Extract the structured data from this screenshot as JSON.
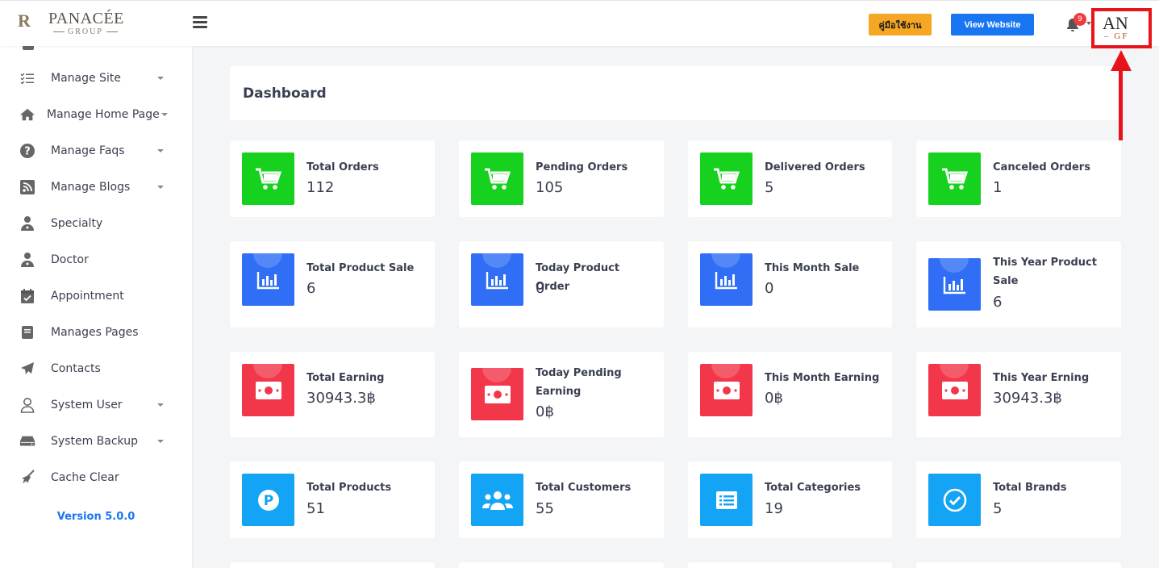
{
  "header": {
    "logo_monogram": "R",
    "logo_brand": "PANACÉE",
    "logo_group": "GROUP",
    "manual_button": "คู่มือใช้งาน",
    "view_website_button": "View Website",
    "notification_count": "9",
    "avatar_text_top": "AN",
    "avatar_text_bottom": "– GF",
    "icons": {
      "menu": "hamburger-icon",
      "bell": "bell-icon"
    }
  },
  "sidebar": {
    "items": [
      {
        "label": "Manage Site",
        "icon": "checklist-icon",
        "has_caret": true
      },
      {
        "label": "Manage Home Page",
        "icon": "home-icon",
        "has_caret": true
      },
      {
        "label": "Manage Faqs",
        "icon": "question-icon",
        "has_caret": true
      },
      {
        "label": "Manage Blogs",
        "icon": "rss-icon",
        "has_caret": true
      },
      {
        "label": "Specialty",
        "icon": "user-doctor-icon",
        "has_caret": false
      },
      {
        "label": "Doctor",
        "icon": "user-doctor-icon",
        "has_caret": false
      },
      {
        "label": "Appointment",
        "icon": "calendar-check-icon",
        "has_caret": false
      },
      {
        "label": "Manages Pages",
        "icon": "book-icon",
        "has_caret": false
      },
      {
        "label": "Contacts",
        "icon": "paper-plane-icon",
        "has_caret": false
      },
      {
        "label": "System User",
        "icon": "user-icon",
        "has_caret": true
      },
      {
        "label": "System Backup",
        "icon": "hdd-icon",
        "has_caret": true
      },
      {
        "label": "Cache Clear",
        "icon": "broom-icon",
        "has_caret": false
      }
    ],
    "version": "Version 5.0.0"
  },
  "dashboard": {
    "title": "Dashboard",
    "cards": [
      {
        "title": "Total Orders",
        "value": "112",
        "color": "#16d11e",
        "icon": "cart-icon"
      },
      {
        "title": "Pending Orders",
        "value": "105",
        "color": "#16d11e",
        "icon": "cart-icon"
      },
      {
        "title": "Delivered Orders",
        "value": "5",
        "color": "#16d11e",
        "icon": "cart-icon"
      },
      {
        "title": "Canceled Orders",
        "value": "1",
        "color": "#16d11e",
        "icon": "cart-icon"
      },
      {
        "title": "Total Product Sale",
        "value": "6",
        "color": "#2f6ef5",
        "icon": "bar-chart-icon"
      },
      {
        "title": "Today Product Order",
        "value": "0",
        "color": "#2f6ef5",
        "icon": "bar-chart-icon"
      },
      {
        "title": "This Month Sale",
        "value": "0",
        "color": "#2f6ef5",
        "icon": "bar-chart-icon"
      },
      {
        "title": "This Year Product Sale",
        "value": "6",
        "color": "#2f6ef5",
        "icon": "bar-chart-icon"
      },
      {
        "title": "Total Earning",
        "value": "30943.3฿",
        "color": "#f2374b",
        "icon": "money-bill-icon"
      },
      {
        "title": "Today Pending Earning",
        "value": "0฿",
        "color": "#f2374b",
        "icon": "money-bill-icon"
      },
      {
        "title": "This Month Earning",
        "value": "0฿",
        "color": "#f2374b",
        "icon": "money-bill-icon"
      },
      {
        "title": "This Year Erning",
        "value": "30943.3฿",
        "color": "#f2374b",
        "icon": "money-bill-icon"
      },
      {
        "title": "Total Products",
        "value": "51",
        "color": "#14a4f5",
        "icon": "parking-icon"
      },
      {
        "title": "Total Customers",
        "value": "55",
        "color": "#14a4f5",
        "icon": "users-icon"
      },
      {
        "title": "Total Categories",
        "value": "19",
        "color": "#14a4f5",
        "icon": "list-icon"
      },
      {
        "title": "Total Brands",
        "value": "5",
        "color": "#14a4f5",
        "icon": "check-circle-icon"
      }
    ]
  },
  "annotation": {
    "color": "#e8141c",
    "icon": "arrow-up-icon"
  }
}
